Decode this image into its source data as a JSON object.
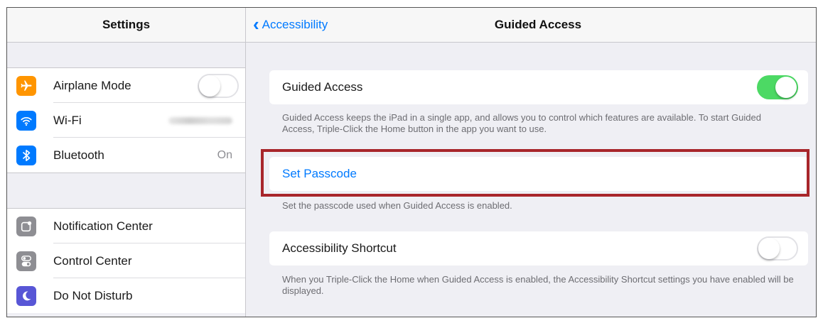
{
  "sidebar": {
    "title": "Settings",
    "group1": [
      {
        "label": "Airplane Mode",
        "icon": "airplane-icon",
        "color": "#ff9500",
        "control": "switch",
        "state": "off"
      },
      {
        "label": "Wi-Fi",
        "icon": "wifi-icon",
        "color": "#007aff",
        "control": "blurred"
      },
      {
        "label": "Bluetooth",
        "icon": "bluetooth-icon",
        "color": "#007aff",
        "value": "On"
      }
    ],
    "group2": [
      {
        "label": "Notification Center",
        "icon": "notification-center-icon",
        "color": "#8e8e93"
      },
      {
        "label": "Control Center",
        "icon": "control-center-icon",
        "color": "#8e8e93"
      },
      {
        "label": "Do Not Disturb",
        "icon": "moon-icon",
        "color": "#5856d6"
      }
    ]
  },
  "header": {
    "back_label": "Accessibility",
    "title": "Guided Access"
  },
  "main": {
    "guided_access": {
      "label": "Guided Access",
      "state": "on"
    },
    "guided_access_note": "Guided Access keeps the iPad in a single app, and allows you to control which features are available. To start Guided Access, Triple-Click the Home button in the app you want to use.",
    "set_passcode": {
      "label": "Set Passcode"
    },
    "set_passcode_note": "Set the passcode used when Guided Access is enabled.",
    "accessibility_shortcut": {
      "label": "Accessibility Shortcut",
      "state": "off"
    },
    "accessibility_shortcut_note": "When you Triple-Click the Home when Guided Access is enabled, the Accessibility Shortcut settings you have enabled will be displayed."
  },
  "colors": {
    "accent": "#007aff",
    "switch_on": "#4cd964",
    "highlight": "#a8262b"
  }
}
